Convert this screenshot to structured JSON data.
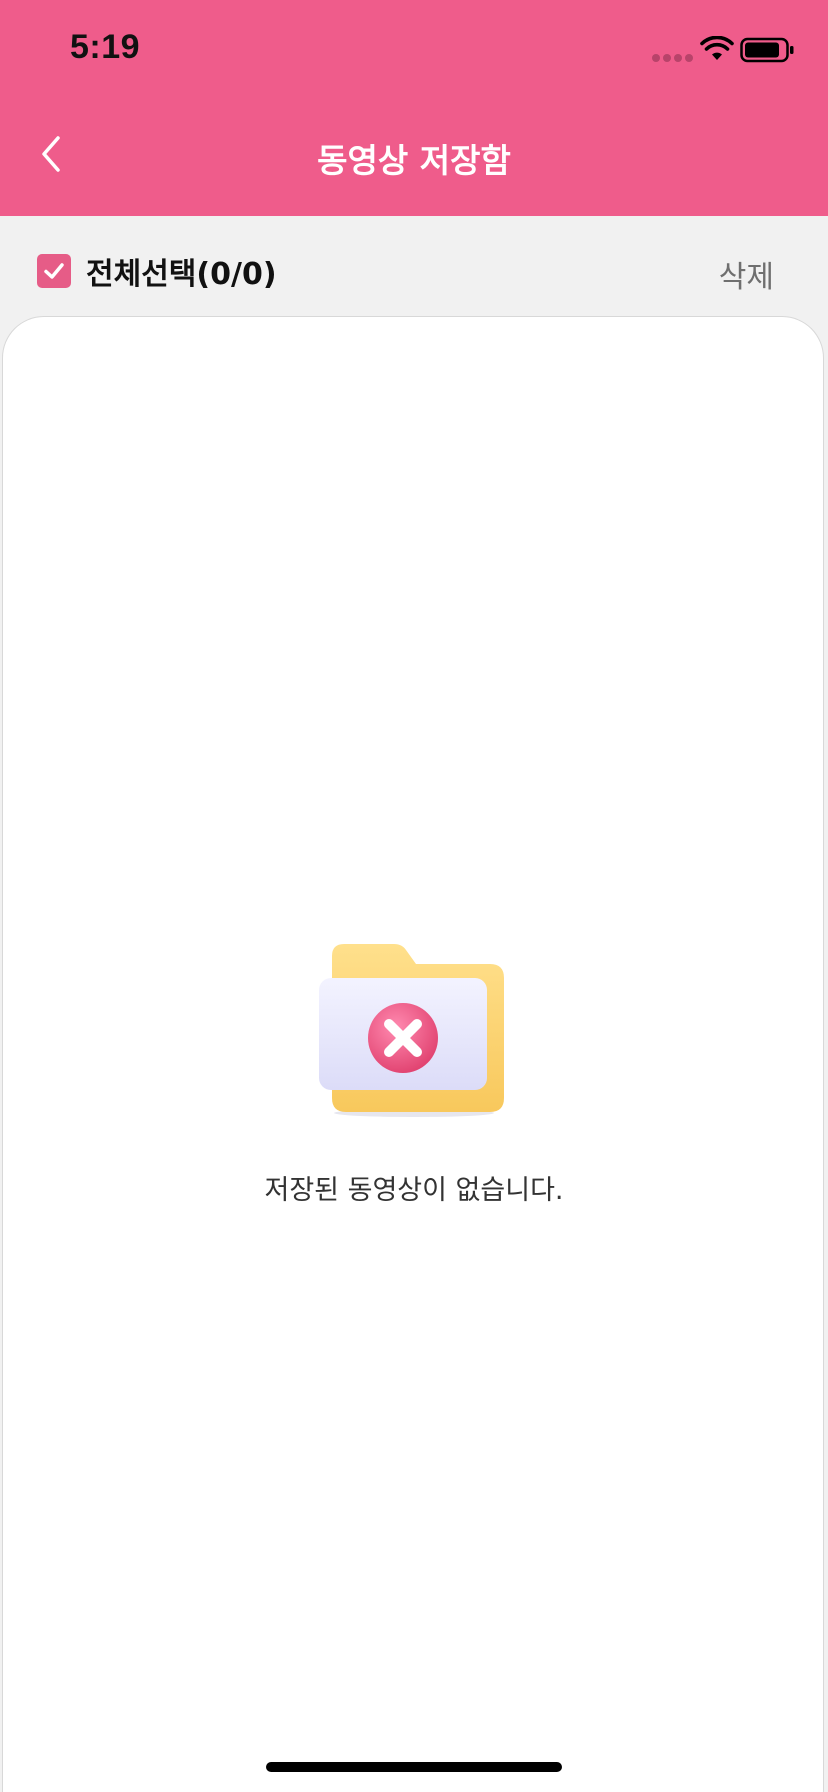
{
  "status_bar": {
    "time": "5:19"
  },
  "header": {
    "title": "동영상 저장함",
    "back_icon": "chevron-left-icon"
  },
  "toolbar": {
    "select_all_label": "전체선택(0/0)",
    "select_all_checked": true,
    "delete_label": "삭제"
  },
  "empty_state": {
    "icon": "empty-folder-icon",
    "message": "저장된 동영상이 없습니다."
  },
  "colors": {
    "accent": "#ef5c8b",
    "checkbox": "#e65c87",
    "background": "#f1f1f1",
    "card": "#ffffff"
  }
}
